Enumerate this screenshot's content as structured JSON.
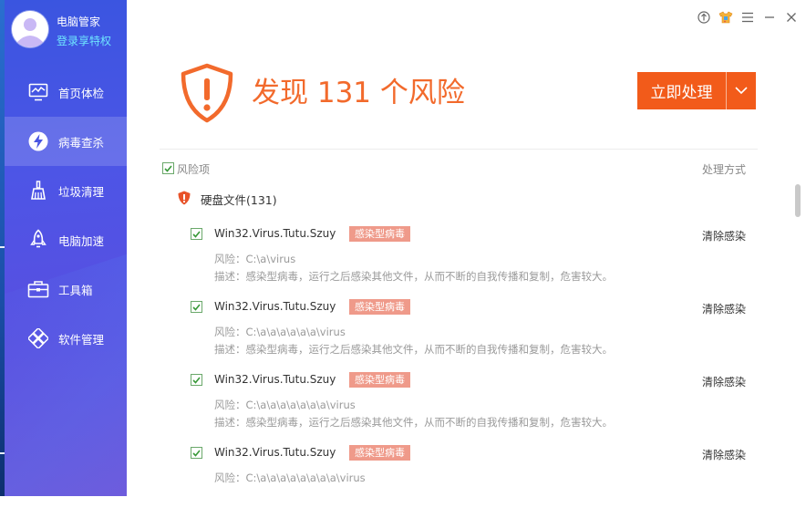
{
  "app": {
    "name": "电脑管家",
    "login_label": "登录享特权"
  },
  "sidebar": {
    "items": [
      {
        "label": "首页体检",
        "icon": "monitor-icon",
        "active": false
      },
      {
        "label": "病毒查杀",
        "icon": "lightning-shield-icon",
        "active": true
      },
      {
        "label": "垃圾清理",
        "icon": "broom-icon",
        "active": false
      },
      {
        "label": "电脑加速",
        "icon": "rocket-icon",
        "active": false
      },
      {
        "label": "工具箱",
        "icon": "toolbox-icon",
        "active": false
      },
      {
        "label": "软件管理",
        "icon": "software-icon",
        "active": false
      }
    ]
  },
  "window_controls": [
    "upload-icon",
    "skin-icon",
    "menu-icon",
    "minimize-icon",
    "close-icon"
  ],
  "header": {
    "headline": "发现 131 个风险",
    "action_label": "立即处理"
  },
  "table": {
    "col_risk": "风险项",
    "col_method": "处理方式",
    "group_label": "硬盘文件(131)"
  },
  "items": [
    {
      "name": "Win32.Virus.Tutu.Szuy",
      "tag": "感染型病毒",
      "path": "风险：C:\\a\\virus",
      "desc": "描述：感染型病毒，运行之后感染其他文件，从而不断的自我传播和复制，危害较大。",
      "action": "清除感染"
    },
    {
      "name": "Win32.Virus.Tutu.Szuy",
      "tag": "感染型病毒",
      "path": "风险：C:\\a\\a\\a\\a\\a\\a\\virus",
      "desc": "描述：感染型病毒，运行之后感染其他文件，从而不断的自我传播和复制，危害较大。",
      "action": "清除感染"
    },
    {
      "name": "Win32.Virus.Tutu.Szuy",
      "tag": "感染型病毒",
      "path": "风险：C:\\a\\a\\a\\a\\a\\a\\a\\virus",
      "desc": "描述：感染型病毒，运行之后感染其他文件，从而不断的自我传播和复制，危害较大。",
      "action": "清除感染"
    },
    {
      "name": "Win32.Virus.Tutu.Szuy",
      "tag": "感染型病毒",
      "path": "风险：C:\\a\\a\\a\\a\\a\\a\\a\\a\\virus",
      "desc": "",
      "action": "清除感染"
    }
  ],
  "colors": {
    "accent": "#f25b1a",
    "headline": "#f26a2c",
    "tag": "#ef9a8a",
    "sidebar_top": "#3a55e0",
    "sidebar_bottom": "#6a4fd8",
    "login_link": "#6fe6ff"
  }
}
